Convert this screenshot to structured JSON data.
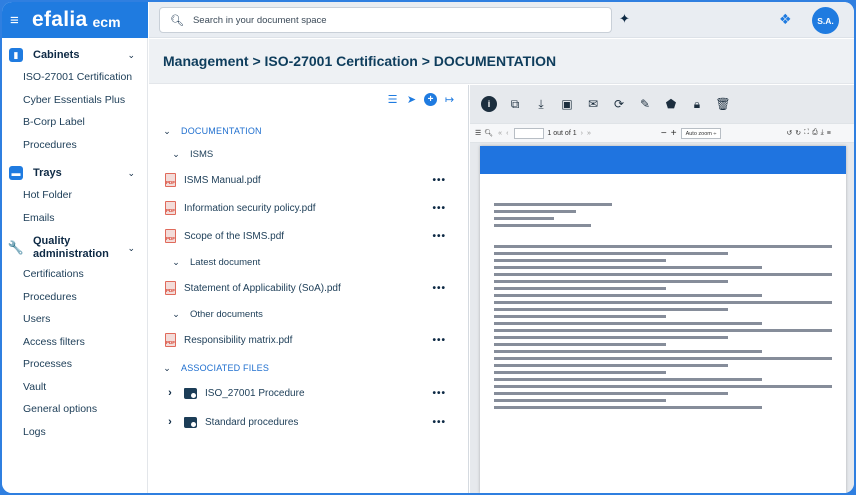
{
  "brand": {
    "logo": "efalia",
    "product": "ecm"
  },
  "search": {
    "placeholder": "Search in your document space"
  },
  "user": {
    "initials": "S.A."
  },
  "sidebar": {
    "cabinets": {
      "label": "Cabinets",
      "items": [
        "ISO-27001 Certification",
        "Cyber Essentials Plus",
        "B-Corp Label",
        "Procedures"
      ]
    },
    "trays": {
      "label": "Trays",
      "items": [
        "Hot Folder",
        "Emails"
      ]
    },
    "quality": {
      "label_line1": "Quality",
      "label_line2": "administration",
      "items": [
        "Certifications",
        "Procedures",
        "Users",
        "Access filters",
        "Processes",
        "Vault",
        "General options",
        "Logs"
      ]
    }
  },
  "breadcrumb": "Management > ISO-27001 Certification > DOCUMENTATION",
  "tree": {
    "documentation": "DOCUMENTATION",
    "isms": "ISMS",
    "isms_files": [
      "ISMS Manual.pdf",
      "Information security policy.pdf",
      "Scope of the ISMS.pdf"
    ],
    "latest": "Latest document",
    "latest_files": [
      "Statement of Applicability (SoA).pdf"
    ],
    "other": "Other documents",
    "other_files": [
      "Responsibility matrix.pdf"
    ],
    "associated": "ASSOCIATED FILES",
    "associated_folders": [
      "ISO_27001 Procedure",
      "Standard procedures"
    ],
    "more": "•••"
  },
  "viewer": {
    "page_of": "1 out of 1",
    "zoom": "Auto zoom ÷"
  },
  "colors": {
    "accent": "#1f7be0",
    "dark": "#0e2a45"
  }
}
